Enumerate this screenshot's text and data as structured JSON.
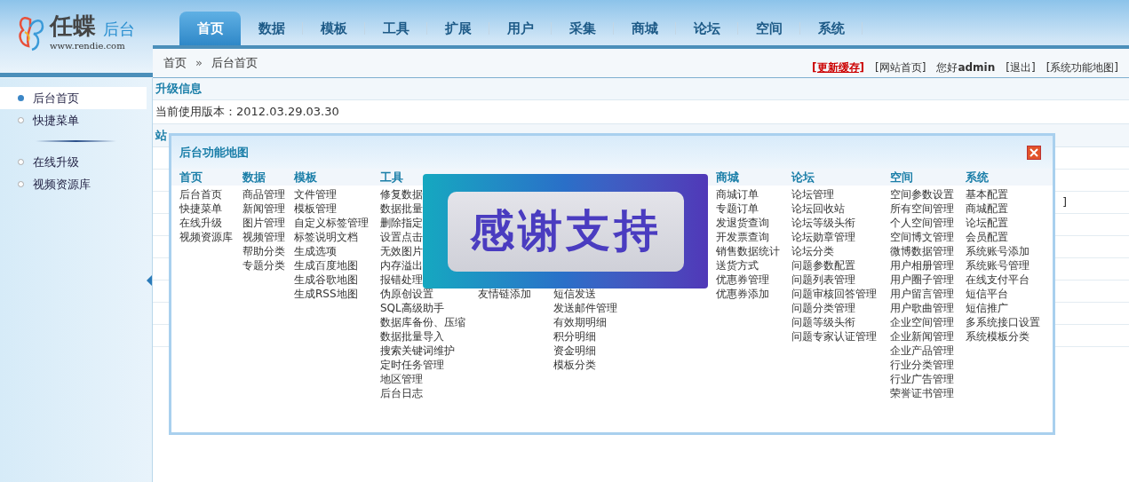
{
  "logo": {
    "name": "任蝶",
    "suffix": "后台",
    "url": "www.rendie.com"
  },
  "nav_tabs": [
    {
      "label": "首页",
      "selected": true
    },
    {
      "label": "数据",
      "selected": false
    },
    {
      "label": "模板",
      "selected": false
    },
    {
      "label": "工具",
      "selected": false
    },
    {
      "label": "扩展",
      "selected": false
    },
    {
      "label": "用户",
      "selected": false
    },
    {
      "label": "采集",
      "selected": false
    },
    {
      "label": "商城",
      "selected": false
    },
    {
      "label": "论坛",
      "selected": false
    },
    {
      "label": "空间",
      "selected": false
    },
    {
      "label": "系统",
      "selected": false
    }
  ],
  "breadcrumb": {
    "items": [
      "首页",
      "后台首页"
    ],
    "separator": "»"
  },
  "top_links": [
    {
      "kind": "alert",
      "text": "[更新缓存]"
    },
    {
      "kind": "link",
      "text": "[网站首页]"
    },
    {
      "kind": "greeting",
      "text": "您好**admin**"
    },
    {
      "kind": "link",
      "text": "[退出]"
    },
    {
      "kind": "link",
      "text": "[系统功能地图]"
    }
  ],
  "sidebar": {
    "groups": [
      {
        "items": [
          {
            "label": "后台首页",
            "selected": true
          },
          {
            "label": "快捷菜单",
            "selected": false
          }
        ]
      },
      {
        "items": [
          {
            "label": "在线升级",
            "selected": false
          },
          {
            "label": "视频资源库",
            "selected": false
          }
        ]
      }
    ]
  },
  "upgrade_info": {
    "title": "升级信息",
    "version": "当前使用版本：2012.03.29.03.30"
  },
  "site_info": {
    "title": "站",
    "cut_text": "]"
  },
  "function_map": {
    "title": "后台功能地图",
    "columns": [
      {
        "kind": "full",
        "heading": "首页",
        "items": [
          "后台首页",
          "快捷菜单",
          "在线升级",
          "视频资源库"
        ]
      },
      {
        "kind": "full",
        "heading": "数据",
        "items": [
          "商品管理",
          "新闻管理",
          "图片管理",
          "视频管理",
          "帮助分类",
          "专题分类"
        ]
      },
      {
        "kind": "full",
        "heading": "模板",
        "items": [
          "文件管理",
          "模板管理",
          "自定义标签管理",
          "标签说明文档",
          "生成选项",
          "生成百度地图",
          "生成谷歌地图",
          "生成RSS地图"
        ]
      },
      {
        "kind": "full",
        "heading": "工具",
        "items": [
          "修复数据",
          "数据批量",
          "删除指定",
          "设置点击",
          "无效图片",
          "内存溢出",
          "报错处理",
          "伪原创设置",
          "SQL高级助手",
          "数据库备份、压缩",
          "数据批量导入",
          "搜索关键词维护",
          "定时任务管理",
          "地区管理",
          "后台日志"
        ]
      },
      {
        "kind": "covered",
        "items": [
          "友情链添加"
        ]
      },
      {
        "kind": "covered",
        "items": [
          "短信发送",
          "发送邮件管理",
          "有效期明细",
          "积分明细",
          "资金明细",
          "模板分类"
        ]
      },
      {
        "kind": "full",
        "heading": "商城",
        "items": [
          "商城订单",
          "专题订单",
          "发退货查询",
          "开发票查询",
          "销售数据统计",
          "送货方式",
          "优惠券管理",
          "优惠券添加"
        ]
      },
      {
        "kind": "full",
        "heading": "论坛",
        "items": [
          "论坛管理",
          "论坛回收站",
          "论坛等级头衔",
          "论坛勋章管理",
          "论坛分类",
          "问题参数配置",
          "问题列表管理",
          "问题审核回答管理",
          "问题分类管理",
          "问题等级头衔",
          "问题专家认证管理"
        ]
      },
      {
        "kind": "full",
        "heading": "空间",
        "items": [
          "空间参数设置",
          "所有空间管理",
          "个人空间管理",
          "空间博文管理",
          "微博数据管理",
          "用户相册管理",
          "用户圈子管理",
          "用户留言管理",
          "用户歌曲管理",
          "企业空间管理",
          "企业新闻管理",
          "企业产品管理",
          "行业分类管理",
          "行业广告管理",
          "荣誉证书管理"
        ]
      },
      {
        "kind": "full",
        "heading": "系统",
        "items": [
          "基本配置",
          "商城配置",
          "论坛配置",
          "会员配置",
          "系统账号添加",
          "系统账号管理",
          "在线支付平台",
          "短信平台",
          "短信推广",
          "多系统接口设置",
          "系统模板分类"
        ]
      }
    ]
  },
  "banner": {
    "text": "感谢支持"
  }
}
